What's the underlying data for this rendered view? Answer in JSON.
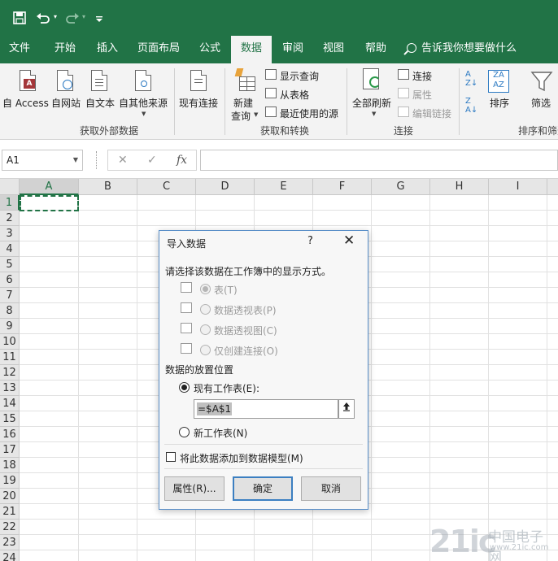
{
  "qat": {
    "save_icon": "save-icon",
    "undo_icon": "undo-icon",
    "redo_icon": "redo-icon",
    "customize_icon": "customize-icon"
  },
  "tabs": [
    {
      "label": "文件"
    },
    {
      "label": "开始"
    },
    {
      "label": "插入"
    },
    {
      "label": "页面布局"
    },
    {
      "label": "公式"
    },
    {
      "label": "数据"
    },
    {
      "label": "审阅"
    },
    {
      "label": "视图"
    },
    {
      "label": "帮助"
    }
  ],
  "active_tab": "数据",
  "tell_me": "告诉我你想要做什么",
  "ribbon": {
    "external": {
      "from_access": "自 Access",
      "from_web": "自网站",
      "from_text": "自文本",
      "from_other": "自其他来源",
      "existing": "现有连接",
      "label": "获取外部数据"
    },
    "transform": {
      "new_query_1": "新建",
      "new_query_2": "查询",
      "show_queries": "显示查询",
      "from_table": "从表格",
      "recent_sources": "最近使用的源",
      "label": "获取和转换"
    },
    "connections": {
      "refresh_all": "全部刷新",
      "connections": "连接",
      "properties": "属性",
      "edit_links": "编辑链接",
      "label": "连接"
    },
    "sort": {
      "sort": "排序",
      "filter": "筛选",
      "label": "排序和筛选"
    }
  },
  "formula_bar": {
    "name_box": "A1",
    "cancel": "✕",
    "enter": "✓",
    "fx": "fx",
    "value": ""
  },
  "columns": [
    "A",
    "B",
    "C",
    "D",
    "E",
    "F",
    "G",
    "H",
    "I"
  ],
  "rows": [
    "1",
    "2",
    "3",
    "4",
    "5",
    "6",
    "7",
    "8",
    "9",
    "10",
    "11",
    "12",
    "13",
    "14",
    "15",
    "16",
    "17",
    "18",
    "19",
    "20",
    "21",
    "22",
    "23",
    "24"
  ],
  "selected_cell": "A1",
  "dialog": {
    "title": "导入数据",
    "help": "?",
    "close": "✕",
    "prompt": "请选择该数据在工作簿中的显示方式。",
    "view_options": [
      {
        "label": "表(T)",
        "selected": true
      },
      {
        "label": "数据透视表(P)",
        "selected": false
      },
      {
        "label": "数据透视图(C)",
        "selected": false
      },
      {
        "label": "仅创建连接(O)",
        "selected": false
      }
    ],
    "location_heading": "数据的放置位置",
    "existing_sheet": "现有工作表(E):",
    "range_value": "=$A$1",
    "range_icon": "collapse-arrow-icon",
    "new_sheet": "新工作表(N)",
    "add_to_model": "将此数据添加到数据模型(M)",
    "add_to_model_checked": false,
    "buttons": {
      "properties": "属性(R)...",
      "ok": "确定",
      "cancel": "取消"
    }
  },
  "watermark": {
    "logo": "21ic",
    "cn": "中国电子网",
    "url": "www.21ic.com"
  }
}
